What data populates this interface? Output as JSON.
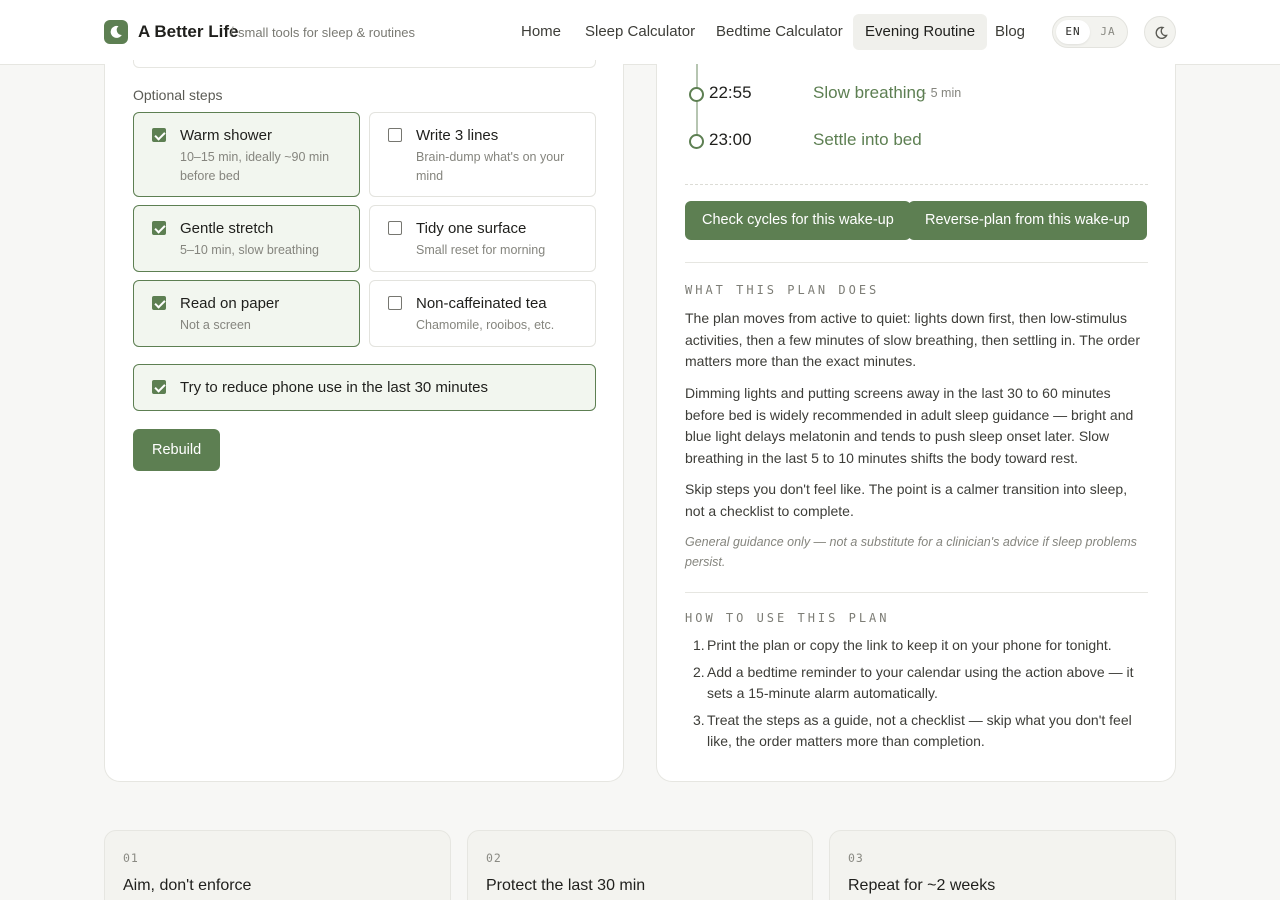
{
  "header": {
    "brand": "A Better Life",
    "separator": "/",
    "tagline": "small tools for sleep & routines",
    "nav": [
      {
        "label": "Home"
      },
      {
        "label": "Sleep Calculator"
      },
      {
        "label": "Bedtime Calculator"
      },
      {
        "label": "Evening Routine",
        "active": true
      },
      {
        "label": "Blog"
      }
    ],
    "languages": [
      "EN",
      "JA"
    ],
    "active_language": "EN"
  },
  "left_panel": {
    "optional_title": "Optional steps",
    "steps": [
      {
        "title": "Warm shower",
        "subtitle": "10–15 min, ideally ~90 min before bed",
        "checked": true
      },
      {
        "title": "Write 3 lines",
        "subtitle": "Brain-dump what's on your mind",
        "checked": false
      },
      {
        "title": "Gentle stretch",
        "subtitle": "5–10 min, slow breathing",
        "checked": true
      },
      {
        "title": "Tidy one surface",
        "subtitle": "Small reset for morning",
        "checked": false
      },
      {
        "title": "Read on paper",
        "subtitle": "Not a screen",
        "checked": true
      },
      {
        "title": "Non-caffeinated tea",
        "subtitle": "Chamomile, rooibos, etc.",
        "checked": false
      }
    ],
    "phone_option": {
      "label": "Try to reduce phone use in the last 30 minutes",
      "checked": true
    },
    "rebuild_label": "Rebuild"
  },
  "right_panel": {
    "timeline": [
      {
        "time": "22:55",
        "label": "Slow breathing",
        "duration": "· 5 min"
      },
      {
        "time": "23:00",
        "label": "Settle into bed",
        "duration": ""
      }
    ],
    "actions": {
      "check_cycles": "Check cycles for this wake-up",
      "reverse_plan": "Reverse-plan from this wake-up"
    },
    "what_title": "WHAT THIS PLAN DOES",
    "what_paragraphs": [
      "The plan moves from active to quiet: lights down first, then low-stimulus activities, then a few minutes of slow breathing, then settling in. The order matters more than the exact minutes.",
      "Dimming lights and putting screens away in the last 30 to 60 minutes before bed is widely recommended in adult sleep guidance — bright and blue light delays melatonin and tends to push sleep onset later. Slow breathing in the last 5 to 10 minutes shifts the body toward rest.",
      "Skip steps you don't feel like. The point is a calmer transition into sleep, not a checklist to complete."
    ],
    "disclaimer": "General guidance only — not a substitute for a clinician's advice if sleep problems persist.",
    "howto_title": "HOW TO USE THIS PLAN",
    "howto_items": [
      "Print the plan or copy the link to keep it on your phone for tonight.",
      "Add a bedtime reminder to your calendar using the action above — it sets a 15-minute alarm automatically.",
      "Treat the steps as a guide, not a checklist — skip what you don't feel like, the order matters more than completion."
    ]
  },
  "cards": [
    {
      "num": "01",
      "title": "Aim, don't enforce"
    },
    {
      "num": "02",
      "title": "Protect the last 30 min"
    },
    {
      "num": "03",
      "title": "Repeat for ~2 weeks"
    }
  ],
  "colors": {
    "accent": "#5d7f52",
    "accent_tint": "#f2f6ef",
    "background": "#f7f7f5"
  },
  "icons": {
    "logo": "moon-icon",
    "theme": "moon-icon"
  }
}
